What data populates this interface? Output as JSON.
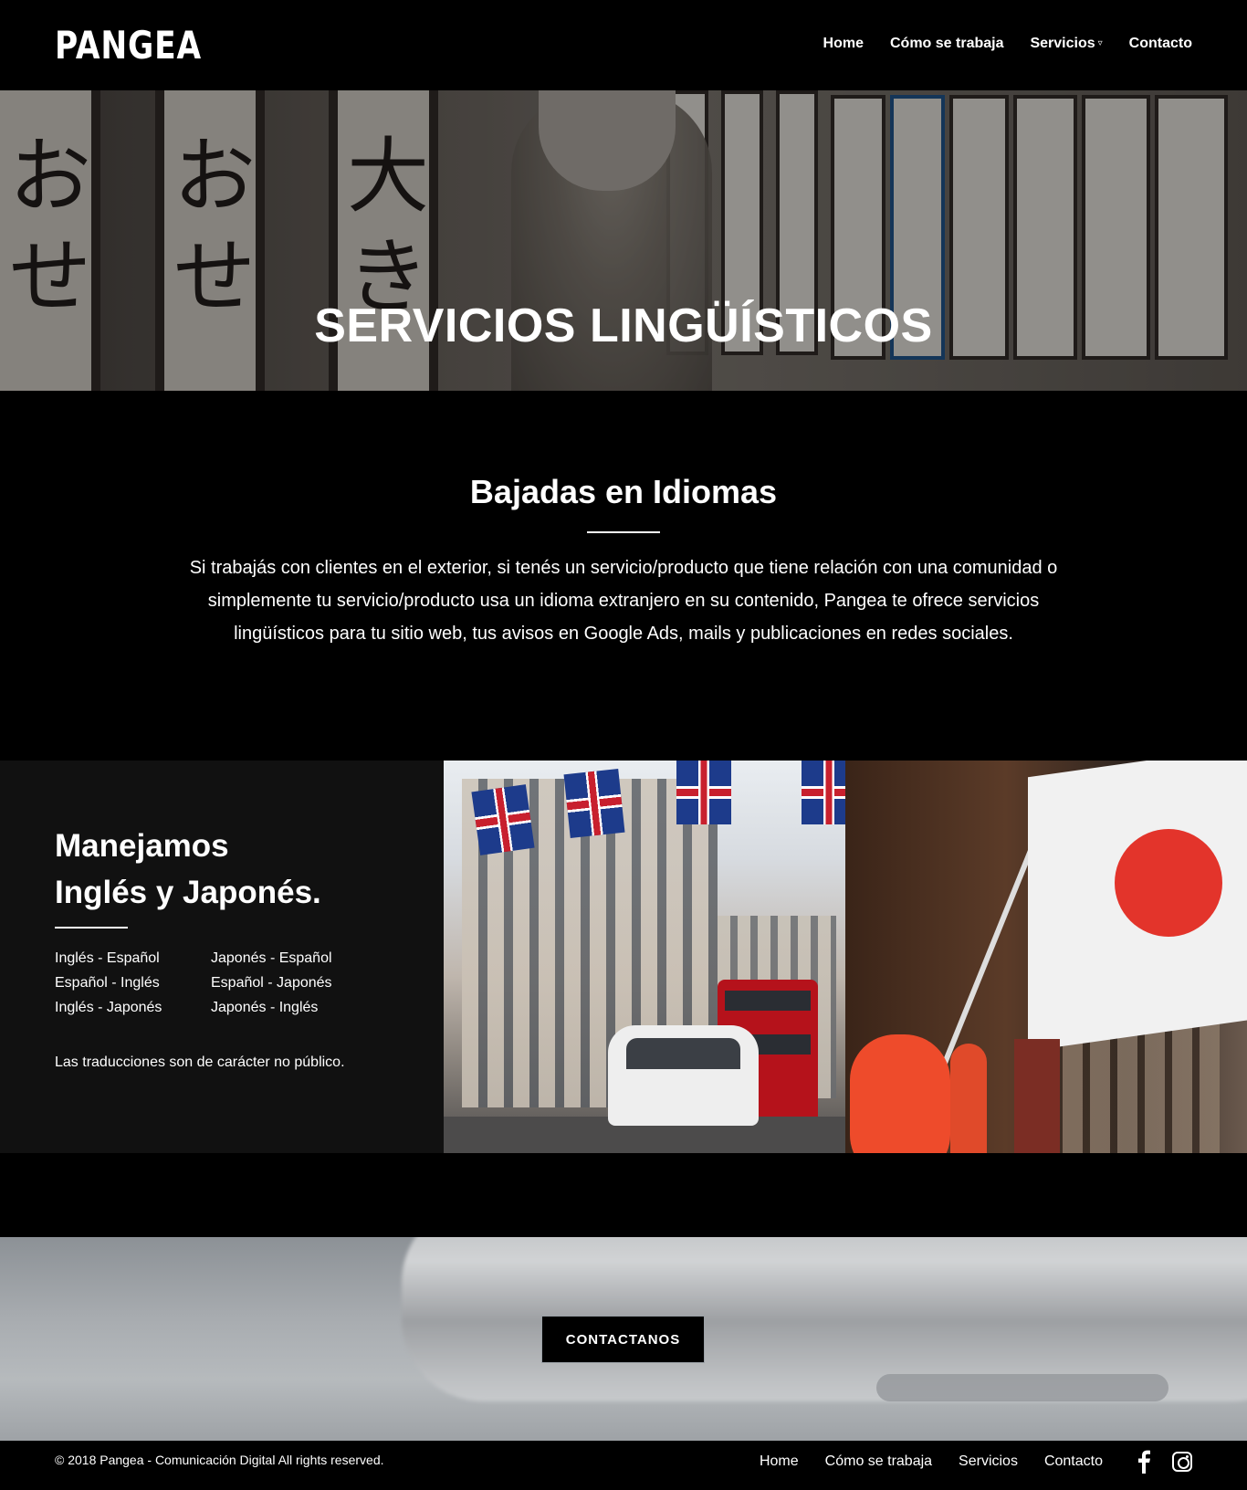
{
  "brand": {
    "logo": "PANGEA"
  },
  "nav": {
    "items": [
      {
        "label": "Home"
      },
      {
        "label": "Cómo se trabaja"
      },
      {
        "label": "Servicios"
      },
      {
        "label": "Contacto"
      }
    ],
    "dropdown_icon": "chevron-down-icon"
  },
  "hero": {
    "title": "SERVICIOS LINGÜÍSTICOS"
  },
  "intro": {
    "heading": "Bajadas en Idiomas",
    "body": "Si trabajás con clientes en el exterior, si tenés un servicio/producto que tiene relación con una comunidad o simplemente tu servicio/producto usa un idioma extranjero en su contenido, Pangea te ofrece servicios lingüísticos para tu sitio web, tus avisos en Google Ads, mails y publicaciones en redes sociales."
  },
  "languages": {
    "heading_line1": "Manejamos",
    "heading_line2": "Inglés y Japonés.",
    "pairs": [
      "Inglés - Español",
      "Japonés - Español",
      "Español - Inglés",
      "Español - Japonés",
      "Inglés - Japonés",
      "Japonés - Inglés"
    ],
    "note": "Las traducciones son de carácter no público."
  },
  "cta": {
    "button_label": "CONTACTANOS"
  },
  "footer": {
    "copyright": "© 2018 Pangea - Comunicación Digital All rights reserved.",
    "links": [
      {
        "label": "Home"
      },
      {
        "label": "Cómo se trabaja"
      },
      {
        "label": "Servicios"
      },
      {
        "label": "Contacto"
      }
    ],
    "social_icons": [
      "facebook-icon",
      "instagram-icon"
    ]
  },
  "colors": {
    "background": "#000000",
    "panel": "#111111",
    "text": "#ffffff"
  }
}
